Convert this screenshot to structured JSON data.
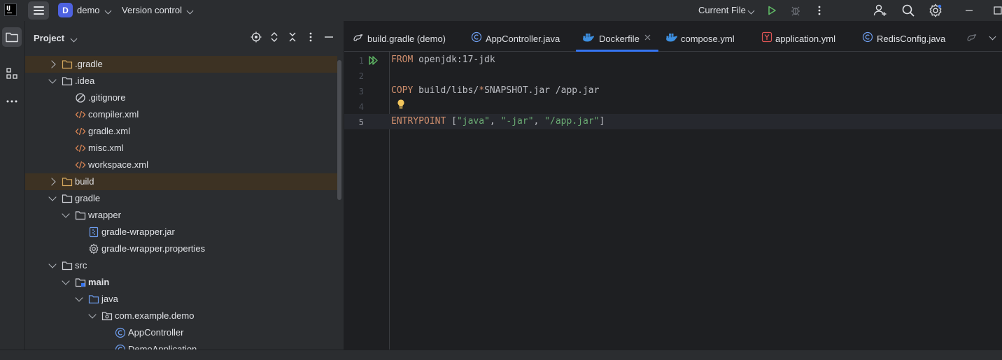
{
  "titlebar": {
    "project_badge": "D",
    "project_name": "demo",
    "vcs_label": "Version control",
    "run_config": "Current File",
    "icons": [
      "app-logo-icon",
      "main-menu-icon",
      "run-icon",
      "debug-icon",
      "more-icon",
      "add-user-icon",
      "search-icon",
      "settings-icon",
      "minimize-icon",
      "maximize-icon"
    ]
  },
  "toolstrip": {
    "icons": [
      "project-folder-icon",
      "structure-icon",
      "more-tools-icon"
    ]
  },
  "project_panel": {
    "title": "Project",
    "header_icons": [
      "locate-icon",
      "expand-all-icon",
      "collapse-all-icon",
      "options-icon",
      "hide-icon"
    ],
    "tree": [
      {
        "label": ".gradle",
        "kind": "folder-excluded",
        "expanded": false
      },
      {
        "label": ".idea",
        "kind": "folder",
        "expanded": true
      },
      {
        "label": ".gitignore",
        "kind": "ignore-file"
      },
      {
        "label": "compiler.xml",
        "kind": "xml-file"
      },
      {
        "label": "gradle.xml",
        "kind": "xml-file"
      },
      {
        "label": "misc.xml",
        "kind": "xml-file"
      },
      {
        "label": "workspace.xml",
        "kind": "xml-file"
      },
      {
        "label": "build",
        "kind": "folder-excluded",
        "expanded": false
      },
      {
        "label": "gradle",
        "kind": "folder",
        "expanded": true
      },
      {
        "label": "wrapper",
        "kind": "folder",
        "expanded": true
      },
      {
        "label": "gradle-wrapper.jar",
        "kind": "jar-file"
      },
      {
        "label": "gradle-wrapper.properties",
        "kind": "properties-file"
      },
      {
        "label": "src",
        "kind": "folder",
        "expanded": true
      },
      {
        "label": "main",
        "kind": "source-root-folder",
        "expanded": true
      },
      {
        "label": "java",
        "kind": "java-folder",
        "expanded": true
      },
      {
        "label": "com.example.demo",
        "kind": "package",
        "expanded": true
      },
      {
        "label": "AppController",
        "kind": "java-class"
      },
      {
        "label": "DemoApplication",
        "kind": "java-class"
      }
    ]
  },
  "editor": {
    "tabs": [
      {
        "label": "build.gradle (demo)",
        "icon": "gradle-icon"
      },
      {
        "label": "AppController.java",
        "icon": "java-class-icon"
      },
      {
        "label": "Dockerfile",
        "icon": "docker-icon",
        "active": true
      },
      {
        "label": "compose.yml",
        "icon": "docker-icon"
      },
      {
        "label": "application.yml",
        "icon": "yaml-icon"
      },
      {
        "label": "RedisConfig.java",
        "icon": "java-class-icon"
      }
    ],
    "line_numbers": [
      "1",
      "2",
      "3",
      "4",
      "5"
    ],
    "current_line": 5,
    "code_lines": [
      [
        {
          "t": "FROM",
          "c": "kw"
        },
        {
          "t": " openjdk:17-jdk",
          "c": "plain"
        }
      ],
      [],
      [
        {
          "t": "COPY",
          "c": "kw"
        },
        {
          "t": " build/libs/",
          "c": "plain"
        },
        {
          "t": "*",
          "c": "kw"
        },
        {
          "t": "SNAPSHOT.jar /app.jar",
          "c": "plain"
        }
      ],
      [],
      [
        {
          "t": "ENTRYPOINT",
          "c": "kw"
        },
        {
          "t": " [",
          "c": "plain"
        },
        {
          "t": "\"java\"",
          "c": "str"
        },
        {
          "t": ", ",
          "c": "plain"
        },
        {
          "t": "\"-jar\"",
          "c": "str"
        },
        {
          "t": ", ",
          "c": "plain"
        },
        {
          "t": "\"/app.jar\"",
          "c": "str"
        },
        {
          "t": "]",
          "c": "plain"
        }
      ]
    ]
  },
  "colors": {
    "accent": "#3574f0",
    "keyword": "#cf8e6d",
    "string": "#6aab73",
    "run_green": "#5fb865",
    "excluded_folder": "#d5a85f",
    "project_badge": "#4e62e0"
  }
}
